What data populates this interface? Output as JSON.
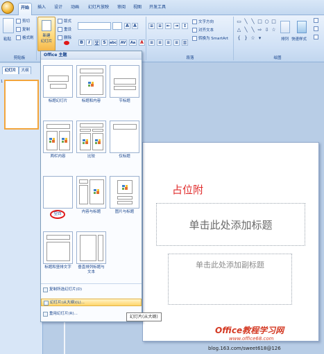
{
  "tabs": [
    {
      "label": "开始",
      "active": true
    },
    {
      "label": "插入",
      "active": false
    },
    {
      "label": "设计",
      "active": false
    },
    {
      "label": "动画",
      "active": false
    },
    {
      "label": "幻灯片放映",
      "active": false
    },
    {
      "label": "审阅",
      "active": false
    },
    {
      "label": "视图",
      "active": false
    },
    {
      "label": "开发工具",
      "active": false
    }
  ],
  "ribbon": {
    "clipboard": {
      "paste": "粘贴",
      "cut": "剪切",
      "copy": "复制",
      "format_painter": "格式刷",
      "group": "剪贴板"
    },
    "slides": {
      "new_slide_line1": "新建",
      "new_slide_line2": "幻灯片",
      "layout": "版式",
      "reset": "重设",
      "delete": "删除"
    },
    "font_buttons": [
      "B",
      "I",
      "U",
      "S",
      "abc",
      "AV",
      "Aa",
      "A"
    ],
    "paragraph": {
      "text_direction": "文字方向",
      "align_text": "对齐文本",
      "convert_smartart": "转换为 SmartArt",
      "group": "段落"
    },
    "drawing": {
      "arrange": "排列",
      "quick_styles": "快速样式",
      "group": "绘图"
    }
  },
  "left_pane": {
    "tab_slides": "幻灯片",
    "tab_outline": "大纲",
    "slide_number": "1"
  },
  "gallery": {
    "header": "Office 主题",
    "layouts": [
      "标题幻灯片",
      "标题和内容",
      "节标题",
      "两栏内容",
      "比较",
      "仅标题",
      "空白",
      "内容与标题",
      "图片与标题",
      "标题和竖排文字",
      "垂直排列标题与文本"
    ],
    "footer": [
      {
        "label": "复制所选幻灯片(D)",
        "highlighted": false
      },
      {
        "label": "幻灯片(从大纲)(L)...",
        "highlighted": true
      },
      {
        "label": "重用幻灯片(R)...",
        "highlighted": false
      }
    ]
  },
  "tooltip": "幻灯片(从大纲)",
  "slide": {
    "annotation": "占位附",
    "title_placeholder": "单击此处添加标题",
    "subtitle_placeholder": "单击此处添加副标题"
  },
  "watermark": {
    "brand": "Office教程学习网",
    "url": "www.office68.com"
  },
  "blog_text": "blog.163.com/sweet618@126"
}
